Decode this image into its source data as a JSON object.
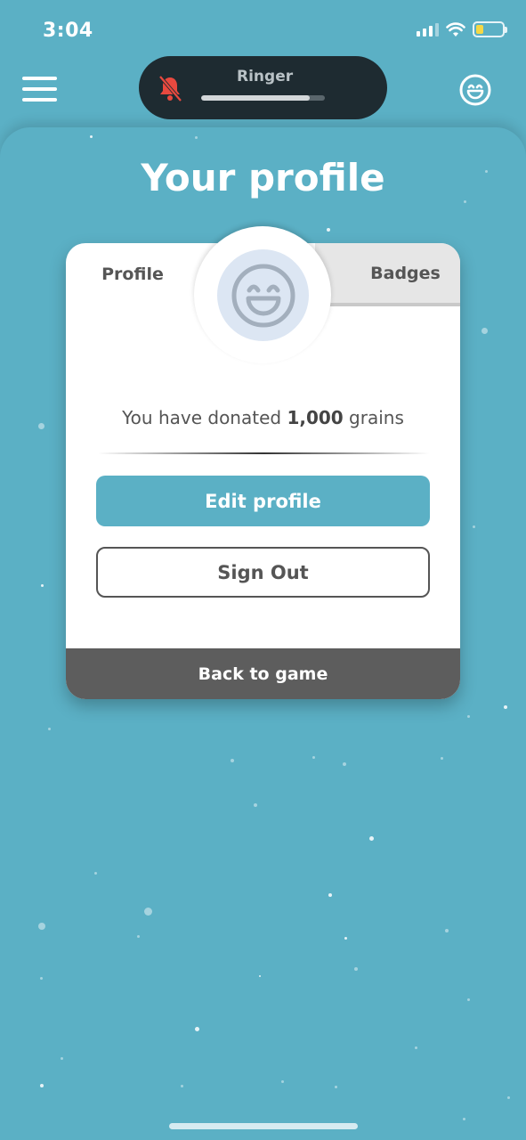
{
  "status_bar": {
    "time": "3:04",
    "battery_color": "#f5d845",
    "signal_bars": 4,
    "signal_active": 3,
    "battery_level": 0.25
  },
  "top_bar": {
    "menu_icon": "hamburger-menu-icon",
    "avatar_icon": "grinning-face-icon"
  },
  "ringer": {
    "label": "Ringer",
    "icon": "bell-slash-icon",
    "icon_color": "#e8493f",
    "level": 0.88
  },
  "page": {
    "title": "Your profile"
  },
  "card": {
    "tabs": {
      "profile": "Profile",
      "badges": "Badges"
    },
    "avatar_icon": "grinning-face-icon",
    "donation": {
      "prefix": "You have donated ",
      "amount": "1,000",
      "suffix": " grains"
    },
    "edit_button": "Edit profile",
    "signout_button": "Sign Out",
    "back_button": "Back to game"
  },
  "colors": {
    "background": "#5bb0c5",
    "card": "#ffffff",
    "accent": "#5bb0c5",
    "dark_bar": "#5d5d5d",
    "avatar_bg": "#dce6f3",
    "avatar_stroke": "#a3afbd"
  }
}
